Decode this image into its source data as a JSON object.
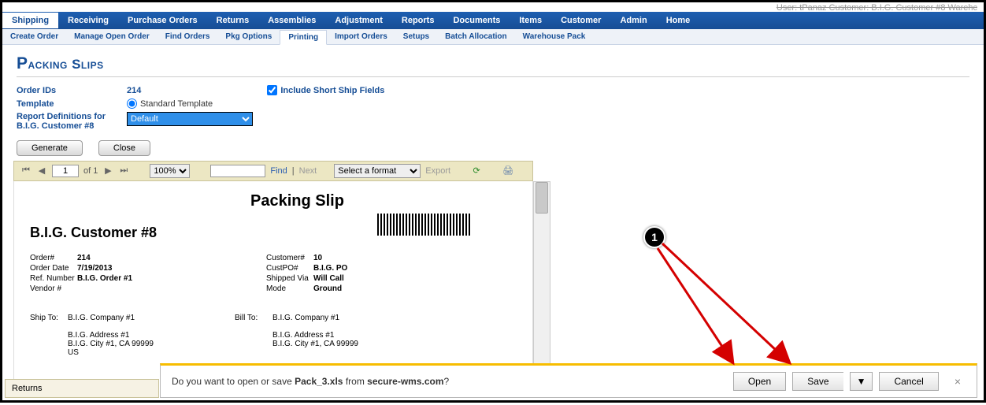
{
  "topinfo": "User: tPanaz   Customer: B.I.G. Customer #8   Warehc",
  "mainnav": [
    "Shipping",
    "Receiving",
    "Purchase Orders",
    "Returns",
    "Assemblies",
    "Adjustment",
    "Reports",
    "Documents",
    "Items",
    "Customer",
    "Admin",
    "Home"
  ],
  "mainnav_active": 0,
  "subnav": [
    "Create Order",
    "Manage Open Order",
    "Find Orders",
    "Pkg Options",
    "Printing",
    "Import Orders",
    "Setups",
    "Batch Allocation",
    "Warehouse Pack"
  ],
  "subnav_active": 4,
  "page_title": "Packing Slips",
  "form": {
    "order_ids_label": "Order IDs",
    "order_ids_value": "214",
    "template_label": "Template",
    "template_value": "Standard Template",
    "reportdef_label": "Report Definitions for B.I.G. Customer #8",
    "reportdef_value": "Default",
    "include_short_label": "Include Short Ship Fields",
    "include_short_checked": true
  },
  "buttons": {
    "generate": "Generate",
    "close": "Close"
  },
  "toolbar": {
    "page_value": "1",
    "page_total": "of 1",
    "zoom": "100%",
    "find": "Find",
    "next": "Next",
    "export_sel": "Select a format",
    "export": "Export"
  },
  "report": {
    "title": "Packing Slip",
    "customer_name": "B.I.G. Customer #8",
    "left": [
      {
        "l": "Order#",
        "v": "214"
      },
      {
        "l": "Order Date",
        "v": "7/19/2013"
      },
      {
        "l": "Ref. Number",
        "v": "B.I.G. Order #1"
      },
      {
        "l": "Vendor #",
        "v": ""
      }
    ],
    "right": [
      {
        "l": "Customer#",
        "v": "10"
      },
      {
        "l": "CustPO#",
        "v": "B.I.G. PO"
      },
      {
        "l": "Shipped Via",
        "v": "Will Call"
      },
      {
        "l": "Mode",
        "v": "Ground"
      }
    ],
    "shipto_label": "Ship To:",
    "billto_label": "Bill To:",
    "shipto": [
      "B.I.G. Company #1",
      "",
      "B.I.G. Address #1",
      "B.I.G. City #1, CA 99999",
      "US"
    ],
    "billto": [
      "B.I.G. Company #1",
      "",
      "B.I.G. Address #1",
      "B.I.G. City #1, CA 99999"
    ]
  },
  "returns_tab": "Returns",
  "download": {
    "prefix": "Do you want to open or save ",
    "file": "Pack_3.xls",
    "mid": " from ",
    "host": "secure-wms.com",
    "suffix": "?",
    "open": "Open",
    "save": "Save",
    "arrow": "▼",
    "cancel": "Cancel",
    "close": "×"
  },
  "badge": "1"
}
